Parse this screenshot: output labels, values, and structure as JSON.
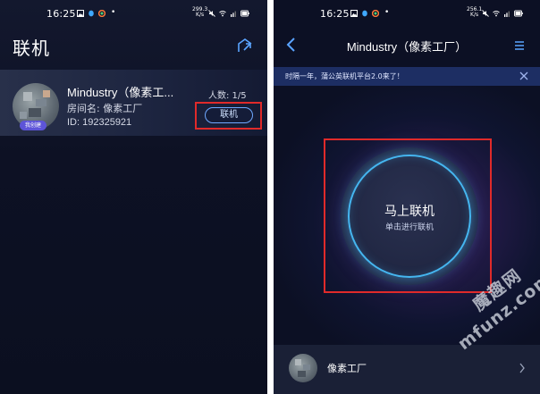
{
  "left": {
    "status": {
      "time": "16:25",
      "net_speed": "299.3",
      "net_unit": "K/s"
    },
    "title": "联机",
    "room": {
      "name": "Mindustry（像素工...",
      "host": "房间名: 像素工厂",
      "id": "ID:  192325921",
      "count": "人数: 1/5",
      "tag": "我创建",
      "join_label": "联机"
    }
  },
  "right": {
    "status": {
      "time": "16:25",
      "net_speed": "256.1",
      "net_unit": "K/s"
    },
    "title": "Mindustry（像素工厂）",
    "banner": "时隔一年，蒲公英联机平台2.0来了！",
    "connect": {
      "title": "马上联机",
      "subtitle": "单击进行联机"
    },
    "room_name": "像素工厂"
  },
  "watermark": {
    "cn": "魔趣网",
    "en": "mfunz.com"
  },
  "colors": {
    "accent": "#45b6f0",
    "highlight": "#e02a2a",
    "banner_bg": "#1d2e63"
  }
}
